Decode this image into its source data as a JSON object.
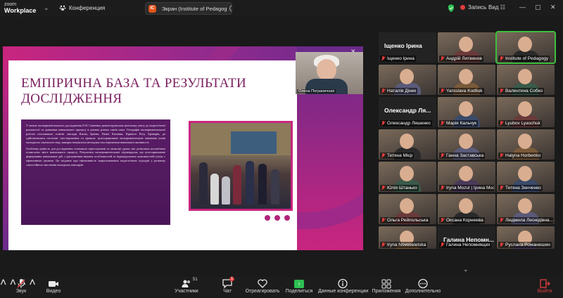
{
  "titlebar": {
    "brand_top": "zoom",
    "brand_bottom": "Workplace",
    "chevron": "⌄",
    "conference": "Конференция",
    "share_logo": "IC",
    "share_title": "Экран (Institute of Pedagog",
    "share_menu": "…",
    "record": "Запись",
    "view": "Вид",
    "view_grid_icon": "☷",
    "minimize": "—",
    "maximize": "▢",
    "close": "✕",
    "colors": {
      "record": "#e23b3b",
      "shield": "#2dbf52"
    }
  },
  "slide": {
    "title": "ЕМПІРИЧНА БАЗА ТА РЕЗУЛЬТАТИ ДОСЛІДЖЕННЯ",
    "para1": "У межах експериментального дослідження О.Я. Савченко демонструвалася цілісному увагу до педагогічної реальності та динаміки навчального процесу в умовах різних типів шкіл. Географія експериментальної роботи охоплювала освітні заклади Києва, Ірпеня, Нової Каховки, Кривого Рогу, Броварів, де здійснювалися системні спостереження та тривале, цілеспрямоване експериментальне навчання учнів молодшого шкільного віку, використовувалися методики спостереження навчальної активності.",
    "para2": "Особливу цінність для дослідження становили зареєстровані та записані уроки, які дозволили поглиблено осмислити зміст навчального процесу. Результати експериментальної підтвердили, що цілеспрямоване формування навчальних дій, з урахуванням вікових особливостей та індивідуальних можливостей учнів, є ефективною умовою. Це свідчить про ефективність запропонованих педагогічних підходів у розвитку самостійного мислення молодших школярів.",
    "close_icon": "✕",
    "colors": {
      "accent": "#c9257f",
      "dark": "#5a1d66"
    }
  },
  "speaker": {
    "name": "Олена Пограничная"
  },
  "gallery": {
    "tiles": [
      {
        "type": "name",
        "name": "Іщенко Ірина",
        "label": "Іщенко Ірина"
      },
      {
        "type": "photo",
        "label": "Андрій Литвинов"
      },
      {
        "type": "photo",
        "label": "Institute of Pedagogy",
        "active": true
      },
      {
        "type": "photo",
        "label": "Наталія Дінек"
      },
      {
        "type": "photo",
        "label": "Yaroslava Kodliuk"
      },
      {
        "type": "photo",
        "label": "Валентина Собко"
      },
      {
        "type": "name",
        "name": "Олександр Ля...",
        "label": "Олександр Ляшенко"
      },
      {
        "type": "photo",
        "label": "Марія Кальчук"
      },
      {
        "type": "photo",
        "label": "Lyubov Lyaschuk"
      },
      {
        "type": "photo",
        "label": "Тетяна Мієр"
      },
      {
        "type": "photo",
        "label": "Ганна Заставська"
      },
      {
        "type": "photo",
        "label": "Halyna Horbenko"
      },
      {
        "type": "photo",
        "label": "Юлія Штанько"
      },
      {
        "type": "photo",
        "label": "Iryna Mozul | Ірина Мозу..."
      },
      {
        "type": "photo",
        "label": "Тетяна Зенченко"
      },
      {
        "type": "photo",
        "label": "Ольга Рейпольська"
      },
      {
        "type": "photo",
        "label": "Оксана Корнеева"
      },
      {
        "type": "photo",
        "label": "Людмила Леонідівна..."
      },
      {
        "type": "photo",
        "label": "Iryna Novoseletska"
      },
      {
        "type": "name",
        "name": "Галина Непомн...",
        "label": "Галина Непомнящих"
      },
      {
        "type": "photo",
        "label": "Руслана Романюшин"
      }
    ],
    "scroll_chevron": "⌄"
  },
  "toolbar": {
    "audio": "Звук",
    "video": "Видео",
    "participants": "Участники",
    "participants_count": "51",
    "chat": "Чат",
    "chat_badge": "1",
    "react": "Отреагировать",
    "share": "Поделиться",
    "info": "Данные конференции",
    "apps": "Приложения",
    "more": "Дополнительно",
    "leave": "Выйти",
    "caret": "˄"
  }
}
